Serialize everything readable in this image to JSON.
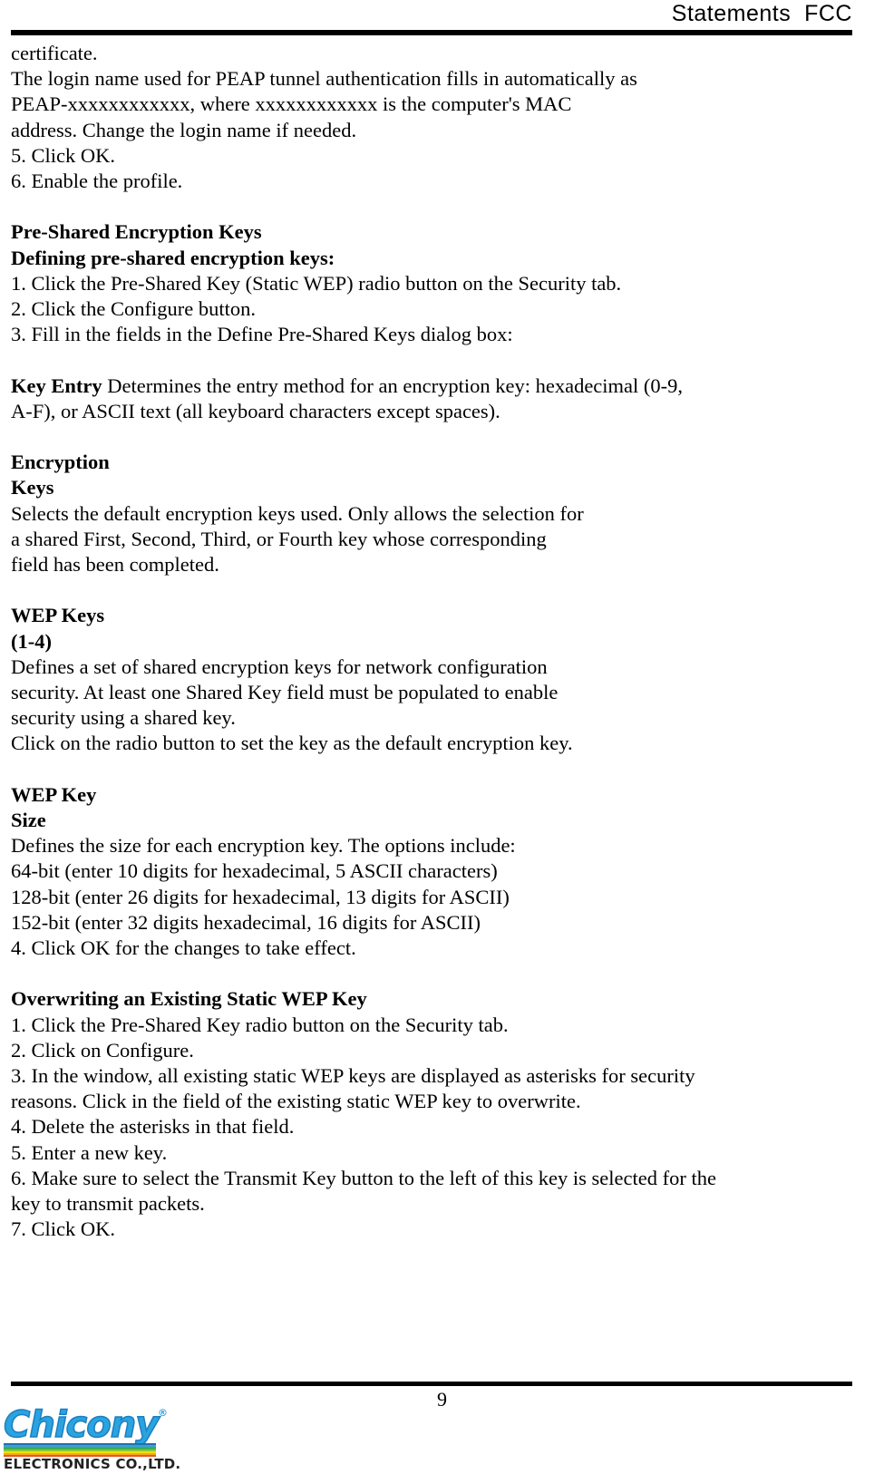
{
  "header": {
    "title": "Statements  FCC"
  },
  "document": {
    "lines": [
      {
        "text": "certificate.",
        "bold": false
      },
      {
        "text": "The login name used for PEAP tunnel authentication fills in automatically as",
        "bold": false
      },
      {
        "text": "PEAP-xxxxxxxxxxxx, where xxxxxxxxxxxx is the computer's MAC",
        "bold": false
      },
      {
        "text": "address. Change the login name if needed.",
        "bold": false
      },
      {
        "text": "5. Click OK.",
        "bold": false
      },
      {
        "text": "6. Enable the profile.",
        "bold": false
      },
      {
        "text": "",
        "bold": false
      },
      {
        "text": "Pre-Shared Encryption Keys",
        "bold": true
      },
      {
        "text": "Defining pre-shared encryption keys:",
        "bold": true
      },
      {
        "text": "1. Click the Pre-Shared Key (Static WEP) radio button on the Security tab.",
        "bold": false
      },
      {
        "text": "2. Click the Configure button.",
        "bold": false
      },
      {
        "text": "3. Fill in the fields in the Define Pre-Shared Keys dialog box:",
        "bold": false
      },
      {
        "text": "",
        "bold": false
      },
      {
        "lead": "Key Entry",
        "text": " Determines the entry method for an encryption key: hexadecimal (0-9,",
        "bold": false
      },
      {
        "text": "A-F), or ASCII text (all keyboard characters except spaces).",
        "bold": false
      },
      {
        "text": "",
        "bold": false
      },
      {
        "text": "Encryption",
        "bold": true
      },
      {
        "text": "Keys",
        "bold": true
      },
      {
        "text": "Selects the default encryption keys used. Only allows the selection for",
        "bold": false
      },
      {
        "text": "a shared First, Second, Third, or Fourth key whose corresponding",
        "bold": false
      },
      {
        "text": "field has been completed.",
        "bold": false
      },
      {
        "text": "",
        "bold": false
      },
      {
        "text": "WEP Keys",
        "bold": true
      },
      {
        "text": "(1-4)",
        "bold": true
      },
      {
        "text": "Defines a set of shared encryption keys for network configuration",
        "bold": false
      },
      {
        "text": "security. At least one Shared Key field must be populated to enable",
        "bold": false
      },
      {
        "text": "security using a shared key.",
        "bold": false
      },
      {
        "text": "Click on the radio button to set the key as the default encryption key.",
        "bold": false
      },
      {
        "text": "",
        "bold": false
      },
      {
        "text": "WEP Key",
        "bold": true
      },
      {
        "text": "Size",
        "bold": true
      },
      {
        "text": "Defines the size for each encryption key. The options include:",
        "bold": false
      },
      {
        "text": "64-bit (enter 10 digits for hexadecimal, 5 ASCII characters)",
        "bold": false
      },
      {
        "text": "128-bit (enter 26 digits for hexadecimal, 13 digits for ASCII)",
        "bold": false
      },
      {
        "text": "152-bit (enter 32 digits hexadecimal, 16 digits for ASCII)",
        "bold": false
      },
      {
        "text": "4. Click OK for the changes to take effect.",
        "bold": false
      },
      {
        "text": "",
        "bold": false
      },
      {
        "text": "Overwriting an Existing Static WEP Key",
        "bold": true
      },
      {
        "text": "1. Click the Pre-Shared Key radio button on the Security tab.",
        "bold": false
      },
      {
        "text": "2. Click on Configure.",
        "bold": false
      },
      {
        "text": "3. In the window, all existing static WEP keys are displayed as asterisks for security",
        "bold": false
      },
      {
        "text": "reasons. Click in the field of the existing static WEP key to overwrite.",
        "bold": false
      },
      {
        "text": "4. Delete the asterisks in that field.",
        "bold": false
      },
      {
        "text": "5. Enter a new key.",
        "bold": false
      },
      {
        "text": "6. Make sure to select the Transmit Key button to the left of this key is selected for the",
        "bold": false
      },
      {
        "text": "key to transmit packets.",
        "bold": false
      },
      {
        "text": "7. Click OK.",
        "bold": false
      }
    ]
  },
  "footer": {
    "page_number": "9",
    "logo": {
      "wordmark": "Chicony",
      "registered_mark": "®",
      "subtitle": "ELECTRONICS CO.,LTD.",
      "wordmark_color": "#2aa3e0",
      "stripe_colors": [
        "#1f6fb5",
        "#3aa0dd",
        "#3fae4a",
        "#8cc63f",
        "#f2e205",
        "#f5a623",
        "#e8562a"
      ]
    }
  }
}
